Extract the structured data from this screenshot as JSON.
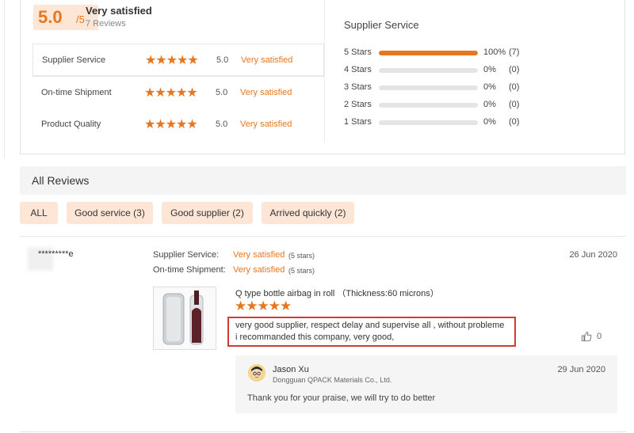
{
  "summary": {
    "score": "5.0",
    "score_out_of": "/5",
    "overall_label": "Very satisfied",
    "review_count": "7 Reviews",
    "ratings": [
      {
        "label": "Supplier Service",
        "stars": "★★★★★",
        "score": "5.0",
        "text": "Very satisfied"
      },
      {
        "label": "On-time Shipment",
        "stars": "★★★★★",
        "score": "5.0",
        "text": "Very satisfied"
      },
      {
        "label": "Product Quality",
        "stars": "★★★★★",
        "score": "5.0",
        "text": "Very satisfied"
      }
    ],
    "distribution_title": "Supplier Service",
    "distribution": [
      {
        "label": "5 Stars",
        "percent": "100%",
        "count": "(7)",
        "fraction": 1.0
      },
      {
        "label": "4 Stars",
        "percent": "0%",
        "count": "(0)",
        "fraction": 0
      },
      {
        "label": "3 Stars",
        "percent": "0%",
        "count": "(0)",
        "fraction": 0
      },
      {
        "label": "2 Stars",
        "percent": "0%",
        "count": "(0)",
        "fraction": 0
      },
      {
        "label": "1 Stars",
        "percent": "0%",
        "count": "(0)",
        "fraction": 0
      }
    ]
  },
  "all_reviews": {
    "title": "All Reviews",
    "filters": [
      "ALL",
      "Good service (3)",
      "Good supplier (2)",
      "Arrived quickly (2)"
    ]
  },
  "review": {
    "reviewer": "*********e",
    "date": "26 Jun 2020",
    "supplier_service_label": "Supplier Service:",
    "supplier_service_value": "Very satisfied",
    "supplier_service_note": "(5 stars)",
    "shipment_label": "On-time Shipment:",
    "shipment_value": "Very satisfied",
    "shipment_note": "(5 stars)",
    "product_name": "Q type bottle airbag in roll （Thickness:60 microns）",
    "product_stars": "★★★★★",
    "text_line1": "very good supplier, respect delay and supervise all , without probleme",
    "text_line2": "i recommanded this company, very good,",
    "likes": "0"
  },
  "reply": {
    "name": "Jason Xu",
    "company": "Dongguan QPACK Materials Co., Ltd.",
    "date": "29 Jun 2020",
    "text": "Thank you for your praise, we will try to do better"
  },
  "colors": {
    "accent": "#e8761f",
    "badge_bg": "#fde6d6",
    "highlight_border": "#d23a33"
  }
}
